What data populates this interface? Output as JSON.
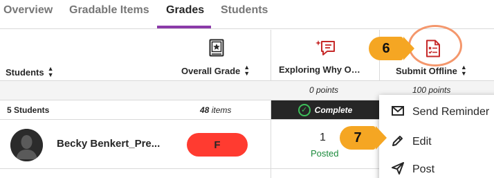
{
  "tabs": [
    {
      "label": "Overview",
      "active": false
    },
    {
      "label": "Gradable Items",
      "active": false
    },
    {
      "label": "Grades",
      "active": true
    },
    {
      "label": "Students",
      "active": false
    }
  ],
  "columns": {
    "students": {
      "label": "Students"
    },
    "overall": {
      "label": "Overall Grade",
      "icon": "gradebook-icon"
    },
    "exploring": {
      "label": "Exploring Why O…",
      "icon": "discussion-icon",
      "points": "0 points"
    },
    "submit": {
      "label": "Submit Offline",
      "icon": "offline-assignment-icon",
      "points": "100 points"
    }
  },
  "summary": {
    "students_count": "5 Students",
    "items_count": "48",
    "items_suffix": "items",
    "status": "Complete"
  },
  "student_row": {
    "name": "Becky Benkert_Pre...",
    "grade": "F",
    "score": "1",
    "status": "Posted"
  },
  "menu": {
    "items": [
      {
        "label": "Send Reminder",
        "icon": "envelope-icon"
      },
      {
        "label": "Edit",
        "icon": "pencil-icon"
      },
      {
        "label": "Post",
        "icon": "send-icon"
      }
    ]
  },
  "callouts": {
    "step6": "6",
    "step7": "7"
  },
  "colors": {
    "accent": "#8b3aa8",
    "grade_fail": "#ff3b30",
    "posted": "#1b8a3b",
    "callout": "#f5a623",
    "complete_bg": "#262626",
    "icon_red": "#c62828"
  }
}
